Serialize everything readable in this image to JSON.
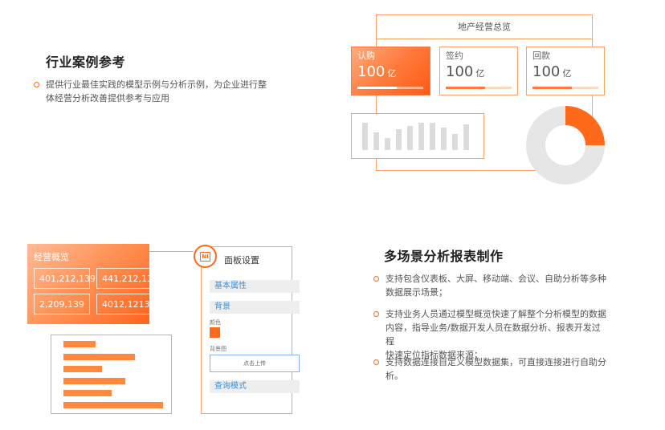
{
  "section1": {
    "title": "行业案例参考",
    "bullets": [
      "提供行业最佳实践的模型示例与分析示例，为企业进行整体经营分析改善提供参考与应用"
    ]
  },
  "section1_lines": [
    "提供行业最佳实践的模型示例与分析示例，为企业进行整",
    "体经营分析改善提供参考与应用"
  ],
  "dashboard": {
    "title": "地产经营总览",
    "kpis": [
      {
        "label": "认购",
        "value": "100",
        "unit": "亿",
        "progress": 0.6
      },
      {
        "label": "签约",
        "value": "100",
        "unit": "亿",
        "progress": 0.6
      },
      {
        "label": "回款",
        "value": "100",
        "unit": "亿",
        "progress": 0.6
      }
    ],
    "donut_progress": 0.25
  },
  "overview": {
    "title": "经营概览",
    "cells": [
      "401,212,139",
      "441,212,139",
      "2,209,139",
      "4012,12139"
    ]
  },
  "settings": {
    "badge": "NI",
    "title": "面板设置",
    "basic": "基本属性",
    "background": "背景",
    "color_label": "颜色",
    "bg_image_label": "背景图",
    "upload_label": "点击上传",
    "query_mode": "查询模式",
    "swatch_color": "#ff6a1a"
  },
  "section2": {
    "title": "多场景分析报表制作",
    "bullets": [
      [
        "支持包含仪表板、大屏、移动端、会议、自助分析等多种",
        "数据展示场景；"
      ],
      [
        "支持业务人员通过模型概览快速了解整个分析模型的数据",
        "内容，指导业务/数据开发人员在数据分析、报表开发过程",
        "快速定位指标数据来源；"
      ],
      [
        "支持数据连接自定义模型数据集，可直接连接进行自助分",
        "析。"
      ]
    ]
  },
  "colors": {
    "accent": "#ff6a1a",
    "frame": "#f8a36a",
    "link": "#3b8fd8"
  }
}
